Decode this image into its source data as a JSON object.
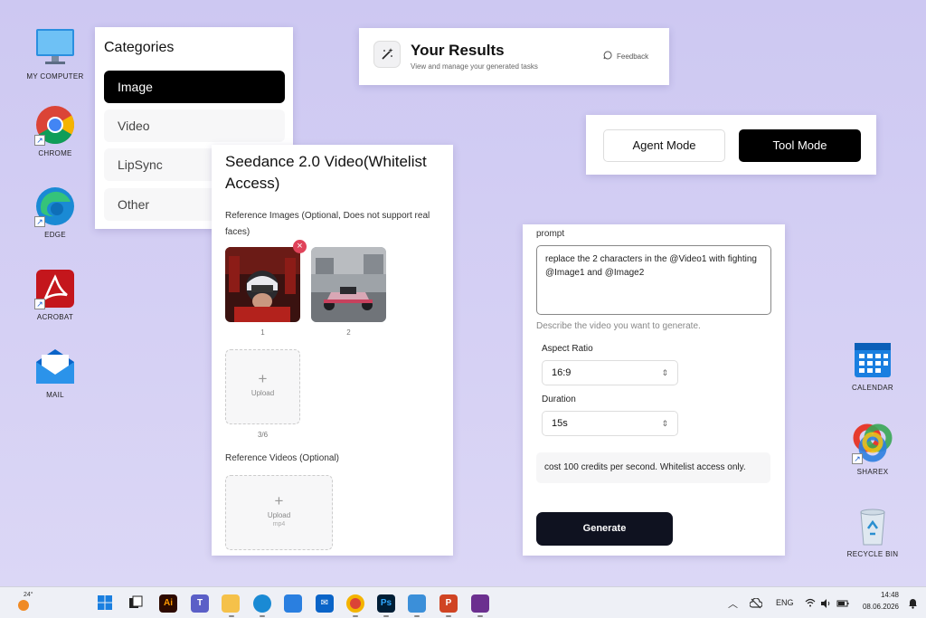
{
  "desktop": {
    "left_icons": [
      {
        "name": "my-computer",
        "label": "MY COMPUTER"
      },
      {
        "name": "chrome",
        "label": "CHROME"
      },
      {
        "name": "edge",
        "label": "EDGE"
      },
      {
        "name": "acrobat",
        "label": "ACROBAT"
      },
      {
        "name": "mail",
        "label": "MAIL"
      }
    ],
    "right_icons": [
      {
        "name": "calendar",
        "label": "CALENDAR"
      },
      {
        "name": "sharex",
        "label": "SHAREX"
      },
      {
        "name": "recycle-bin",
        "label": "RECYCLE BIN"
      }
    ]
  },
  "categories": {
    "title": "Categories",
    "items": [
      "Image",
      "Video",
      "LipSync",
      "Other"
    ],
    "active": "Image"
  },
  "results": {
    "title": "Your Results",
    "subtitle": "View and manage your generated tasks",
    "feedback": "Feedback"
  },
  "mode": {
    "agent": "Agent Mode",
    "tool": "Tool Mode"
  },
  "seedance": {
    "title": "Seedance 2.0 Video(Whitelist Access)",
    "ref_images_label": "Reference Images (Optional, Does not support real faces)",
    "image_1_caption": "1",
    "image_2_caption": "2",
    "upload_label": "Upload",
    "upload_count": "3/6",
    "ref_videos_label": "Reference Videos (Optional)",
    "video_upload_label": "Upload",
    "video_upload_hint": "mp4",
    "remove_symbol": "×",
    "plus_symbol": "+"
  },
  "form": {
    "prompt_label": "prompt",
    "prompt_value": "replace the 2 characters in the @Video1 with fighting @Image1 and @Image2",
    "prompt_hint": "Describe the video you want to generate.",
    "aspect_label": "Aspect Ratio",
    "aspect_value": "16:9",
    "duration_label": "Duration",
    "duration_value": "15s",
    "cost_note": "cost 100 credits per second. Whitelist access only.",
    "generate": "Generate",
    "chevron": "⌃⌄"
  },
  "taskbar": {
    "weather": "24°",
    "lang": "ENG",
    "time": "14:48",
    "date": "08.06.2026",
    "apps": [
      "windows-start",
      "task-view",
      "illustrator",
      "teams",
      "file-explorer",
      "edge",
      "store",
      "mail",
      "chrome",
      "photoshop",
      "photos",
      "powerpoint",
      "winrar"
    ]
  }
}
